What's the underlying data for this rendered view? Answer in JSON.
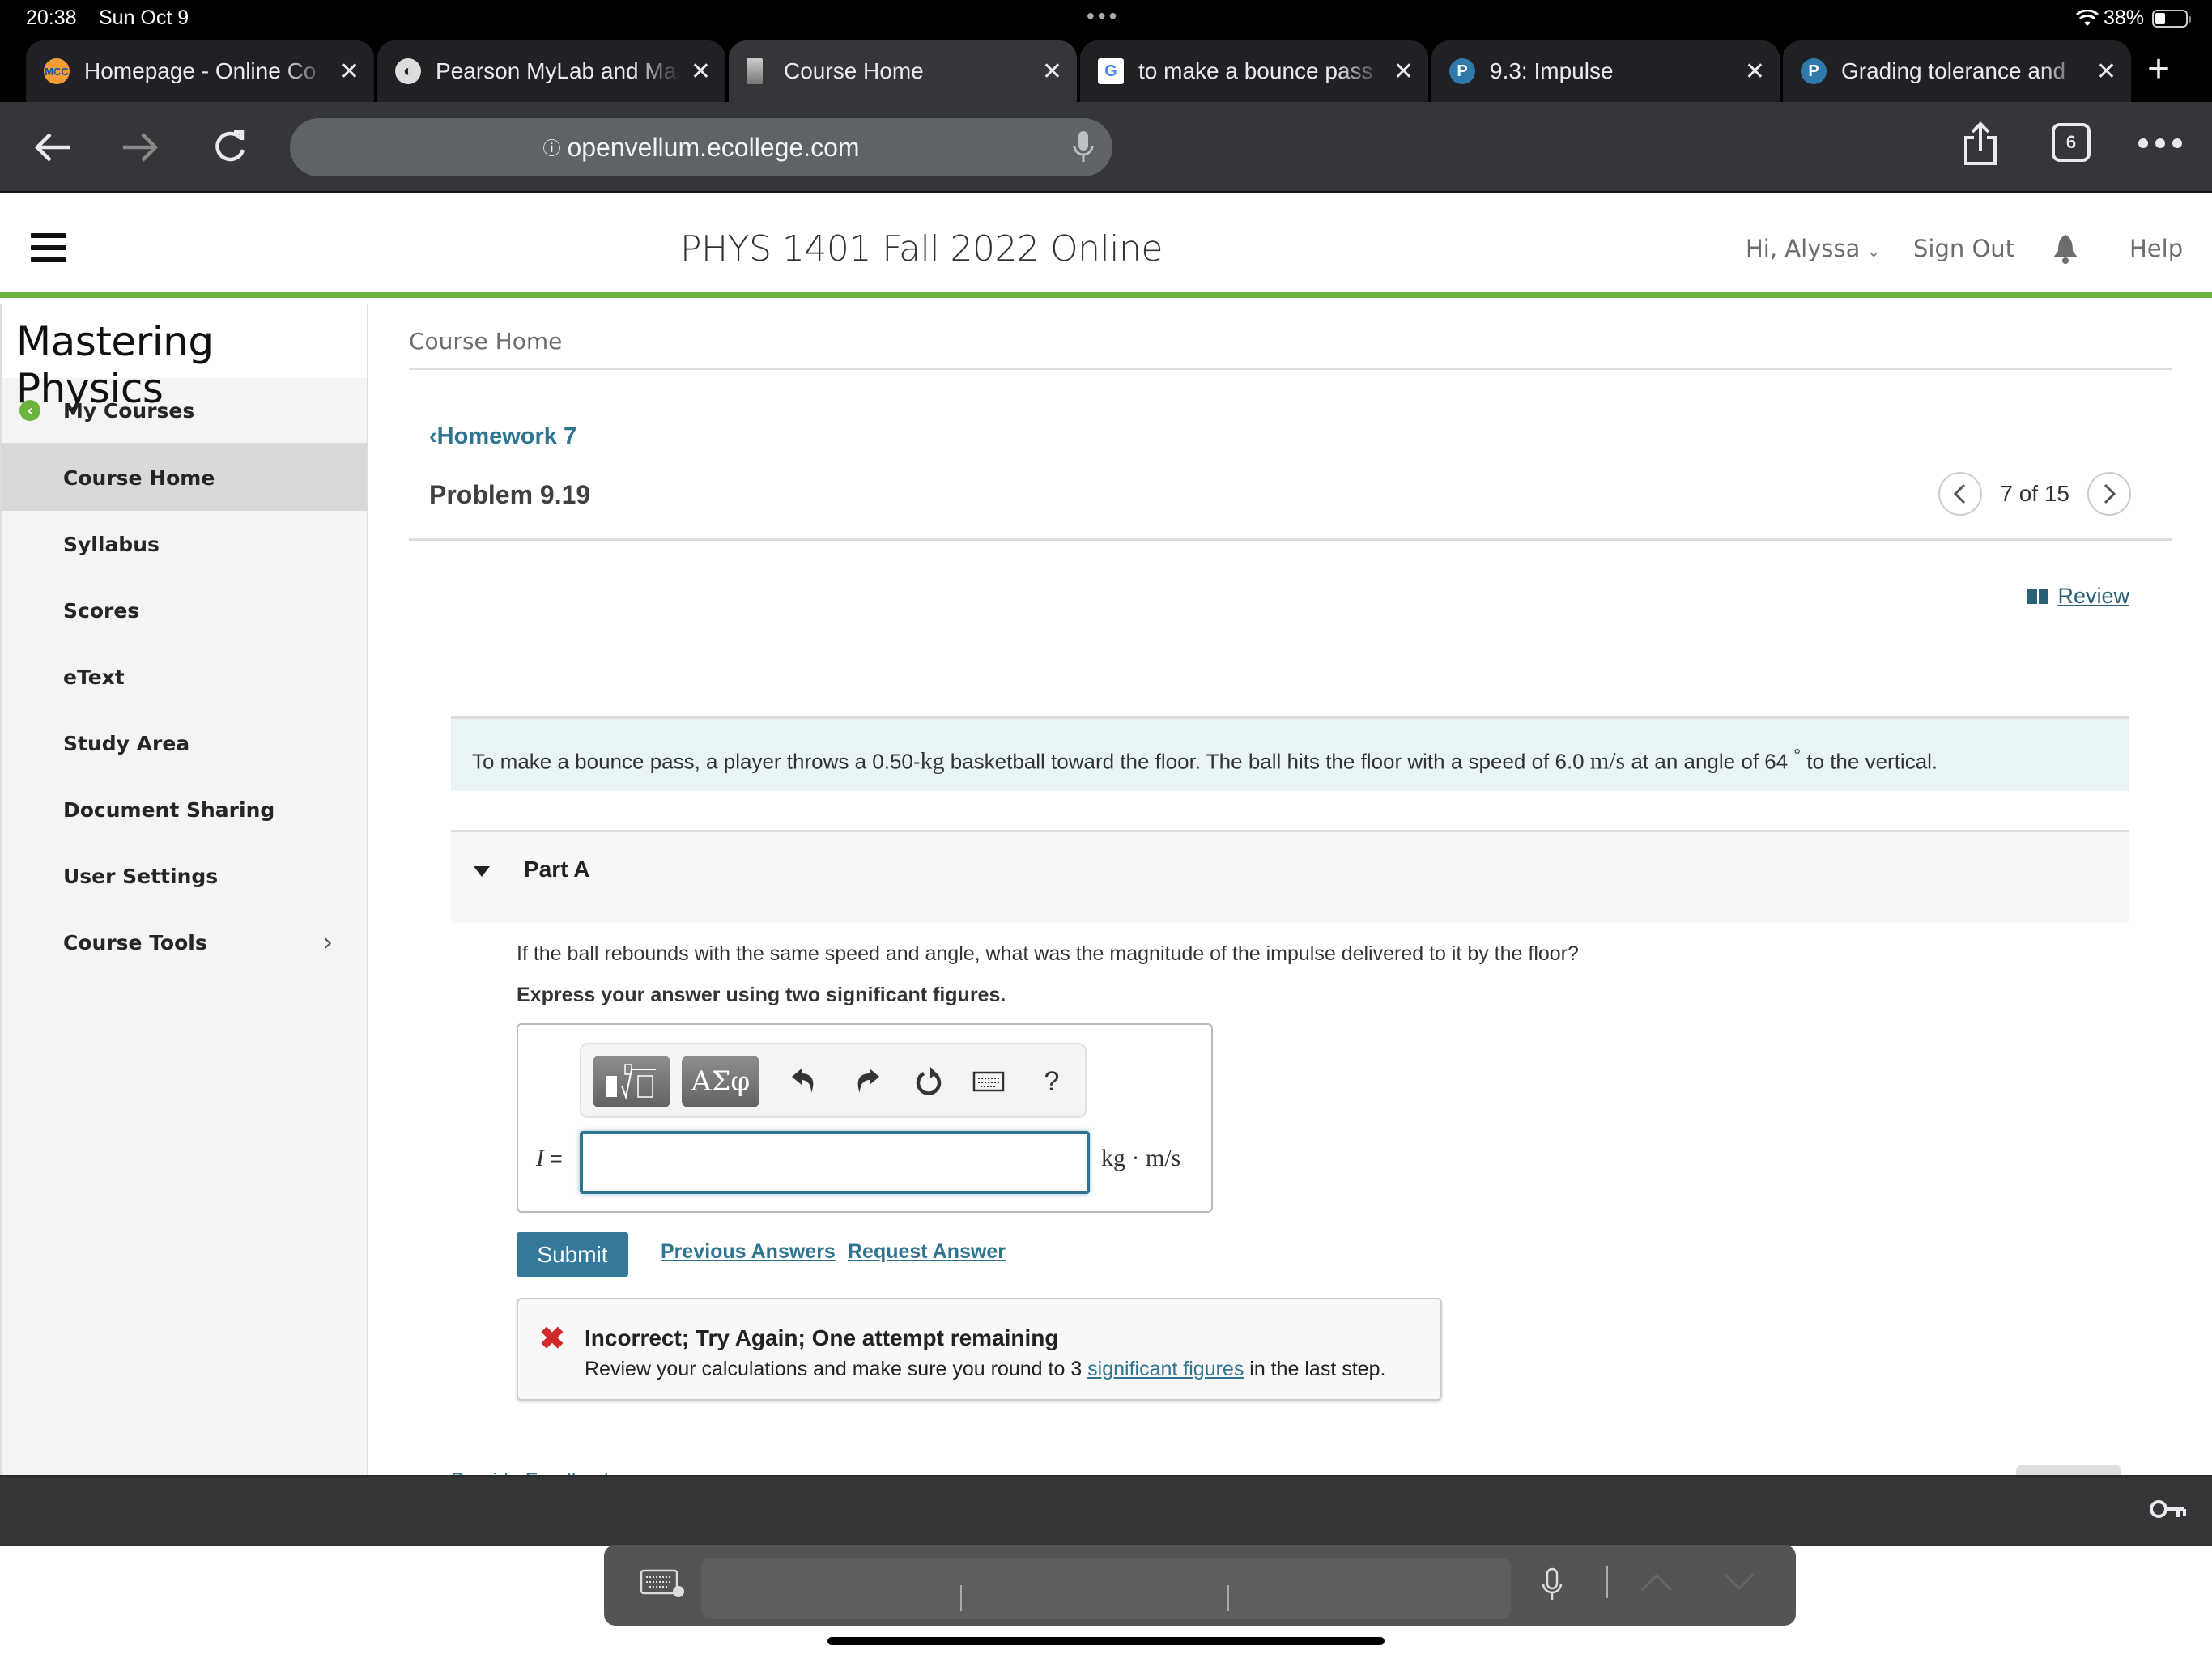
{
  "status_bar": {
    "time": "20:38",
    "date": "Sun Oct 9",
    "battery": "38%"
  },
  "tabs": [
    {
      "title": "Homepage - Online Co",
      "favicon": "mcc-logo",
      "active": false
    },
    {
      "title": "Pearson MyLab and Ma",
      "favicon": "globe-icon",
      "active": false
    },
    {
      "title": "Course Home",
      "favicon": "document-icon",
      "active": true
    },
    {
      "title": "to make a bounce pass",
      "favicon": "google-icon",
      "active": false
    },
    {
      "title": "9.3: Impulse",
      "favicon": "pearson-icon",
      "active": false
    },
    {
      "title": "Grading tolerance and",
      "favicon": "pearson-icon",
      "active": false
    }
  ],
  "toolbar": {
    "url": "openvellum.ecollege.com",
    "tab_count": "6"
  },
  "header": {
    "course_title": "PHYS 1401 Fall 2022 Online",
    "greeting": "Hi, Alyssa",
    "sign_out": "Sign Out",
    "help": "Help"
  },
  "sidebar": {
    "brand": "Mastering Physics",
    "items": [
      {
        "label": "My Courses"
      },
      {
        "label": "Course Home",
        "active": true
      },
      {
        "label": "Syllabus"
      },
      {
        "label": "Scores"
      },
      {
        "label": "eText"
      },
      {
        "label": "Study Area"
      },
      {
        "label": "Document Sharing"
      },
      {
        "label": "User Settings"
      },
      {
        "label": "Course Tools"
      }
    ]
  },
  "main": {
    "breadcrumb": "Course Home",
    "back_link": "Homework 7",
    "problem_title": "Problem 9.19",
    "pager": "7 of 15",
    "review_link": " Review",
    "statement": {
      "part1": "To make a bounce pass, a player throws a 0.50-",
      "unit_kg": "kg",
      "part2": " basketball toward the floor. The ball hits the floor with a speed of 6.0 ",
      "unit_speed": "m/s",
      "part3": " at an angle of 64 ",
      "degree": "°",
      "part4": " to the vertical."
    },
    "part_label": "Part A",
    "question": "If the ball rebounds with the same speed and angle, what was the magnitude of the impulse delivered to it by the floor?",
    "instruction": "Express your answer using two significant figures.",
    "answer": {
      "variable": "I",
      "equals": "=",
      "value": "",
      "units": "kg · m/s",
      "greek_button": "ΑΣφ",
      "help_button": "?"
    },
    "submit_label": "Submit",
    "previous_answers": "Previous Answers",
    "request_answer": "Request Answer",
    "feedback": {
      "heading": "Incorrect; Try Again; One attempt remaining",
      "body_before": "Review your calculations and make sure you round to 3 ",
      "body_link": "significant figures",
      "body_after": " in the last step."
    },
    "partial_link": "Provide Feedback"
  },
  "colors": {
    "accent_green": "#6db33f",
    "link_blue": "#2f7491",
    "submit_blue": "#34789a",
    "error_red": "#d02a2a"
  }
}
